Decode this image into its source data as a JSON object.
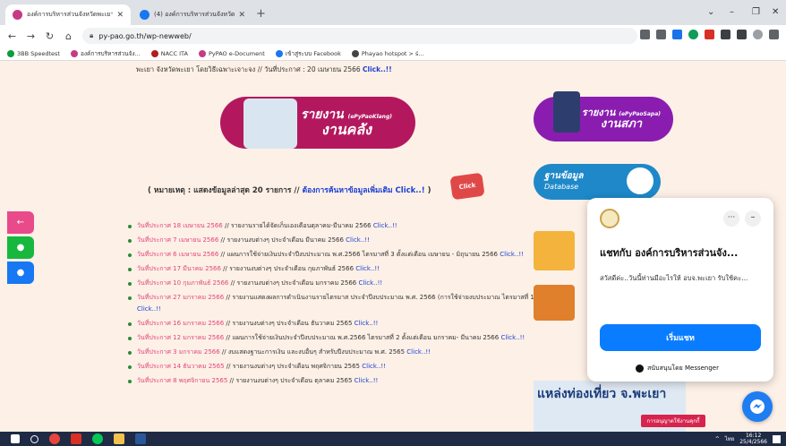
{
  "browser": {
    "tabs": [
      {
        "title": "องค์การบริหารส่วนจังหวัดพะเยา – Pha",
        "active": true
      },
      {
        "title": "(4) องค์การบริหารส่วนจังหวัดพะเยา | F",
        "active": false
      }
    ],
    "new_tab": "+",
    "url": "py-pao.go.th/wp-newweb/",
    "window_controls": [
      "⌄",
      "–",
      "❐",
      "✕"
    ]
  },
  "bookmarks": [
    "3BB Speedtest",
    "องค์การบริหารส่วนจัง...",
    "NACC ITA",
    "PyPAO e-Document",
    "เข้าสู่ระบบ Facebook",
    "Phayao hotspot > ś..."
  ],
  "page": {
    "top_line": "พะเยา จังหวัดพะเยา โดยวิธีเฉพาะเจาะจง // วันที่ประกาศ : 20 เมษายน 2566",
    "top_click": "Click..!!",
    "banner_finance": {
      "title": "รายงาน",
      "sub": "(ePyPaoKlang)",
      "title2": "งานคลัง"
    },
    "banner_council": {
      "title": "รายงาน",
      "sub": "(ePyPaoSapa)",
      "title2": "งานสภา"
    },
    "banner_database": {
      "title": "ฐานข้อมูล",
      "sub": "Database"
    },
    "note_prefix": "( หมายเหตุ : แสดงข้อมูลล่าสุด 20 รายการ //",
    "note_link": "ต้องการค้นหาข้อมูลเพิ่มเติม Click..!",
    "note_suffix": ")",
    "click_button": "Click",
    "news": [
      {
        "date": "วันที่ประกาศ 18 เมษายน 2566",
        "text": " // รายงานรายได้จัดเก็บเองเดือนตุลาคม-มีนาคม 2566 ",
        "click": "Click..!!"
      },
      {
        "date": "วันที่ประกาศ 7 เมษายน 2566",
        "text": " // รายงานงบต่างๆ ประจำเดือน มีนาคม 2566 ",
        "click": "Click..!!"
      },
      {
        "date": "วันที่ประกาศ 6 เมษายน 2566",
        "text": " // แผนการใช้จ่ายเงินประจำปีงบประมาณ พ.ศ.2566 ไตรมาสที่ 3 ตั้งแต่เดือน เมษายน - มิถุนายน 2566 ",
        "click": "Click..!!"
      },
      {
        "date": "วันที่ประกาศ 17 มีนาคม 2566",
        "text": " // รายงานงบต่างๆ ประจำเดือน กุมภาพันธ์ 2566 ",
        "click": "Click..!!"
      },
      {
        "date": "วันที่ประกาศ 10 กุมภาพันธ์ 2566",
        "text": " // รายงานงบต่างๆ ประจำเดือน มกราคม 2566 ",
        "click": "Click..!!"
      },
      {
        "date": "วันที่ประกาศ 27 มกราคม 2566",
        "text": " // รายงานแสดงผลการดำเนินงานรายไตรมาส ประจำปีงบประมาณ พ.ศ. 2566 (การใช้จ่ายงบประมาณ ไตรมาสที่ 1) ",
        "click": "Click..!!"
      },
      {
        "date": "วันที่ประกาศ 16 มกราคม 2566",
        "text": " // รายงานงบต่างๆ ประจำเดือน ธันวาคม 2565 ",
        "click": "Click..!!"
      },
      {
        "date": "วันที่ประกาศ 12 มกราคม 2566",
        "text": " // แผนการใช้จ่ายเงินประจำปีงบประมาณ พ.ศ.2566 ไตรมาสที่ 2 ตั้งแต่เดือน มกราคม- มีนาคม 2566 ",
        "click": "Click..!!"
      },
      {
        "date": "วันที่ประกาศ 3 มกราคม 2566",
        "text": " // งบแสดงฐานะการเงิน และงบอื่นๆ สำหรับปีงบประมาณ พ.ศ. 2565 ",
        "click": "Click..!!"
      },
      {
        "date": "วันที่ประกาศ 14 ธันวาคม 2565",
        "text": " // รายงานงบต่างๆ ประจำเดือน พฤศจิกายน 2565 ",
        "click": "Click..!!"
      },
      {
        "date": "วันที่ประกาศ 8 พฤศจิกายน 2565",
        "text": " // รายงานงบต่างๆ ประจำเดือน ตุลาคม 2565 ",
        "click": "Click..!!"
      }
    ],
    "tourism": "แหล่งท่องเที่ยว จ.พะเยา",
    "tourism_badge": "การอนุญาตใช้งานคุกกี้"
  },
  "chat": {
    "title": "แชทกับ องค์การบริหารส่วนจัง...",
    "message": "สวัสดีค่ะ..วันนี้ท่านมีอะไรให้ อบจ.พะเยา รับใช้คะ...",
    "start_button": "เริ่มแชท",
    "powered": "สนับสนุนโดย Messenger",
    "more": "···",
    "minimize": "–"
  },
  "taskbar": {
    "time": "16:12",
    "date": "25/4/2566",
    "lang": "ไทย"
  },
  "colors": {
    "brand_pink": "#b3185f",
    "brand_purple": "#8a1db0",
    "link_blue": "#1a3fd6",
    "messenger_blue": "#0a7cff"
  }
}
